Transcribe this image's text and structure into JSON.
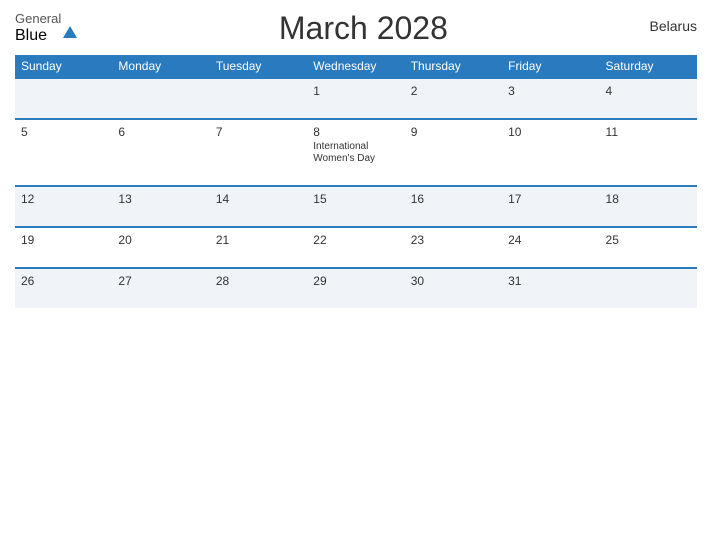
{
  "header": {
    "logo": {
      "line1": "General",
      "line2": "Blue"
    },
    "title": "March 2028",
    "country": "Belarus"
  },
  "weekdays": [
    "Sunday",
    "Monday",
    "Tuesday",
    "Wednesday",
    "Thursday",
    "Friday",
    "Saturday"
  ],
  "weeks": [
    [
      {
        "day": "",
        "holiday": ""
      },
      {
        "day": "",
        "holiday": ""
      },
      {
        "day": "",
        "holiday": ""
      },
      {
        "day": "1",
        "holiday": ""
      },
      {
        "day": "2",
        "holiday": ""
      },
      {
        "day": "3",
        "holiday": ""
      },
      {
        "day": "4",
        "holiday": ""
      }
    ],
    [
      {
        "day": "5",
        "holiday": ""
      },
      {
        "day": "6",
        "holiday": ""
      },
      {
        "day": "7",
        "holiday": ""
      },
      {
        "day": "8",
        "holiday": "International Women's Day"
      },
      {
        "day": "9",
        "holiday": ""
      },
      {
        "day": "10",
        "holiday": ""
      },
      {
        "day": "11",
        "holiday": ""
      }
    ],
    [
      {
        "day": "12",
        "holiday": ""
      },
      {
        "day": "13",
        "holiday": ""
      },
      {
        "day": "14",
        "holiday": ""
      },
      {
        "day": "15",
        "holiday": ""
      },
      {
        "day": "16",
        "holiday": ""
      },
      {
        "day": "17",
        "holiday": ""
      },
      {
        "day": "18",
        "holiday": ""
      }
    ],
    [
      {
        "day": "19",
        "holiday": ""
      },
      {
        "day": "20",
        "holiday": ""
      },
      {
        "day": "21",
        "holiday": ""
      },
      {
        "day": "22",
        "holiday": ""
      },
      {
        "day": "23",
        "holiday": ""
      },
      {
        "day": "24",
        "holiday": ""
      },
      {
        "day": "25",
        "holiday": ""
      }
    ],
    [
      {
        "day": "26",
        "holiday": ""
      },
      {
        "day": "27",
        "holiday": ""
      },
      {
        "day": "28",
        "holiday": ""
      },
      {
        "day": "29",
        "holiday": ""
      },
      {
        "day": "30",
        "holiday": ""
      },
      {
        "day": "31",
        "holiday": ""
      },
      {
        "day": "",
        "holiday": ""
      }
    ]
  ]
}
